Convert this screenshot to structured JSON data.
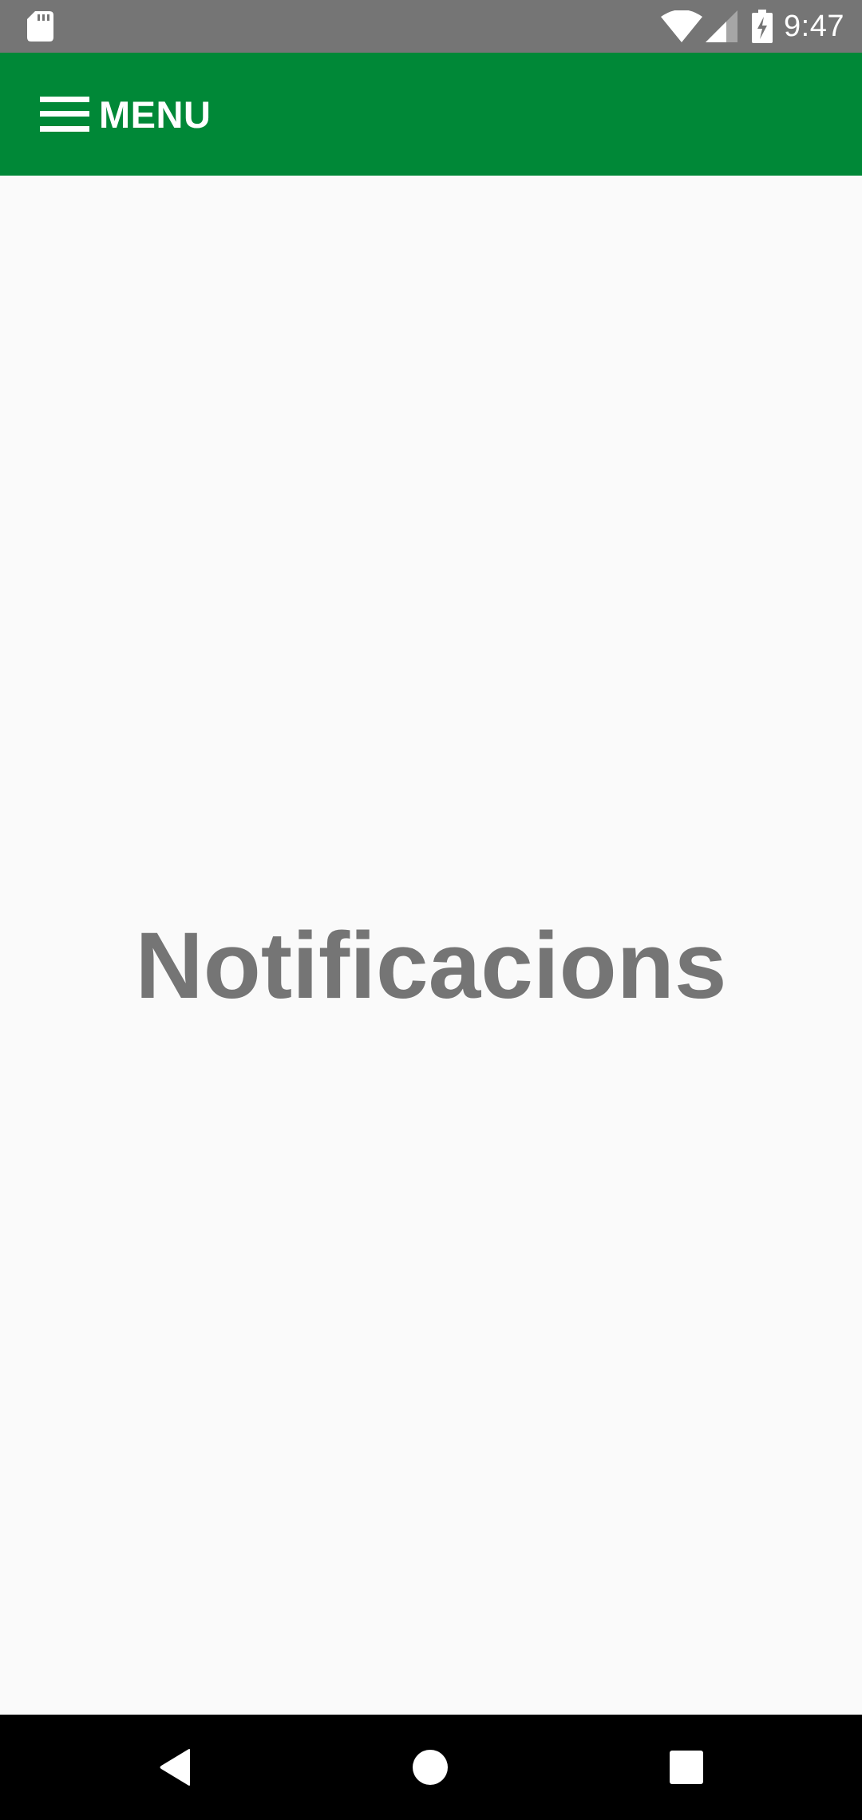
{
  "status_bar": {
    "time": "9:47",
    "left_icon": "sd-card-icon",
    "right_icons": [
      "wifi-icon",
      "signal-icon",
      "battery-charging-icon"
    ]
  },
  "app_bar": {
    "menu_label": "MENU",
    "menu_icon": "hamburger-icon",
    "background_color": "#008837"
  },
  "main": {
    "title": "Notificacions",
    "title_color": "#757575"
  },
  "nav_bar": {
    "buttons": [
      "back-icon",
      "home-icon",
      "recents-icon"
    ]
  }
}
